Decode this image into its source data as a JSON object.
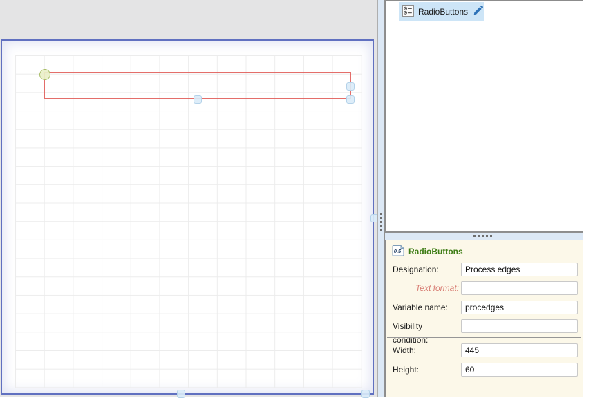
{
  "explorer": {
    "items": [
      {
        "label": "RadioButtons",
        "selected": true,
        "icon": "radiobuttons-icon",
        "edit_icon": "pencil-icon"
      }
    ]
  },
  "properties": {
    "badge": "0.5",
    "title": "RadioButtons",
    "fields": {
      "designation": {
        "label": "Designation:",
        "value": "Process edges"
      },
      "text_format": {
        "label": "Text format:",
        "value": ""
      },
      "variable_name": {
        "label": "Variable name:",
        "value": "procedges"
      },
      "visibility": {
        "label": "Visibility condition:",
        "value": ""
      },
      "width": {
        "label": "Width:",
        "value": "445"
      },
      "height": {
        "label": "Height:",
        "value": "60"
      }
    }
  },
  "icons": {
    "explorer_item": "radiobuttons-icon",
    "edit": "pencil-icon",
    "scale_badge": "scale-badge-icon"
  },
  "colors": {
    "selection_highlight": "#cde5f7",
    "canvas_border": "#6070c0",
    "selection_rect_red": "#e05c5c",
    "handle_green_fill": "#e9f0c8",
    "handle_blue_fill": "#d9ebf8",
    "properties_bg": "#fcf8e9",
    "title_green": "#3e7d16",
    "text_format_label": "#d87e74",
    "pencil_blue": "#2d72b8",
    "workspace_gray": "#e4e4e5"
  }
}
